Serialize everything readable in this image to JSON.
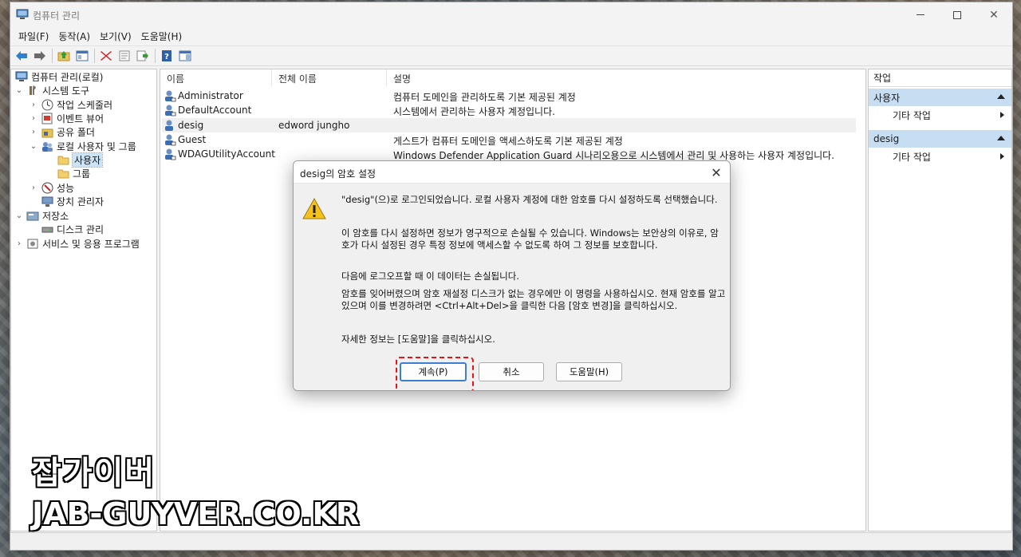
{
  "window": {
    "title": "컴퓨터 관리"
  },
  "menu": [
    "파일(F)",
    "동작(A)",
    "보기(V)",
    "도움말(H)"
  ],
  "toolbar": {
    "icons": [
      "back-arrow-icon",
      "forward-arrow-icon",
      "up-folder-icon",
      "show-hide-tree-icon",
      "delete-icon",
      "properties-icon",
      "export-icon",
      "help-icon",
      "action-pane-icon"
    ]
  },
  "tree": {
    "items": [
      {
        "label": "컴퓨터 관리(로컬)"
      },
      {
        "label": "시스템 도구"
      },
      {
        "label": "작업 스케줄러"
      },
      {
        "label": "이벤트 뷰어"
      },
      {
        "label": "공유 폴더"
      },
      {
        "label": "로컬 사용자 및 그룹"
      },
      {
        "label": "사용자"
      },
      {
        "label": "그룹"
      },
      {
        "label": "성능"
      },
      {
        "label": "장치 관리자"
      },
      {
        "label": "저장소"
      },
      {
        "label": "디스크 관리"
      },
      {
        "label": "서비스 및 응용 프로그램"
      }
    ]
  },
  "list": {
    "columns": [
      "이름",
      "전체 이름",
      "설명"
    ],
    "rows": [
      {
        "name": "Administrator",
        "fullname": "",
        "desc": "컴퓨터 도메인을 관리하도록 기본 제공된 계정"
      },
      {
        "name": "DefaultAccount",
        "fullname": "",
        "desc": "시스템에서 관리하는 사용자 계정입니다."
      },
      {
        "name": "desig",
        "fullname": "edword jungho",
        "desc": ""
      },
      {
        "name": "Guest",
        "fullname": "",
        "desc": "게스트가 컴퓨터 도메인을 액세스하도록 기본 제공된 계정"
      },
      {
        "name": "WDAGUtilityAccount",
        "fullname": "",
        "desc": "Windows Defender Application Guard 시나리오용으로 시스템에서 관리 및 사용하는 사용자 계정입니다."
      }
    ]
  },
  "actions": {
    "header": "작업",
    "sections": [
      {
        "title": "사용자",
        "item": "기타 작업"
      },
      {
        "title": "desig",
        "item": "기타 작업"
      }
    ]
  },
  "dialog": {
    "title": "desig의 암호 설정",
    "p1": "\"desig\"(으)로 로그인되었습니다. 로컬 사용자 계정에 대한 암호를 다시 설정하도록 선택했습니다.",
    "p2": "이 암호를 다시 설정하면 정보가 영구적으로 손실될 수 있습니다. Windows는 보안상의 이유로, 암호가 다시 설정된 경우 특정 정보에 액세스할 수 없도록 하여 그 정보를 보호합니다.",
    "p3": "다음에 로그오프할 때 이 데이터는 손실됩니다.",
    "p4": "암호를 잊어버렸으며 암호 재설정 디스크가 없는 경우에만 이 명령을 사용하십시오. 현재 암호를 알고 있으며 이를 변경하려면 <Ctrl+Alt+Del>을 클릭한 다음 [암호 변경]을 클릭하십시오.",
    "p5": "자세한 정보는 [도움말]을 클릭하십시오.",
    "buttons": {
      "proceed": "계속(P)",
      "cancel": "취소",
      "help": "도움말(H)"
    }
  },
  "watermark": {
    "korean": "잡가이버",
    "domain": "JAB-GUYVER.CO.KR"
  },
  "colors": {
    "selection": "#cce4f7",
    "action_section": "#c7ddf1",
    "highlight_box": "#e01515",
    "primary_button": "#3c7ed6"
  }
}
